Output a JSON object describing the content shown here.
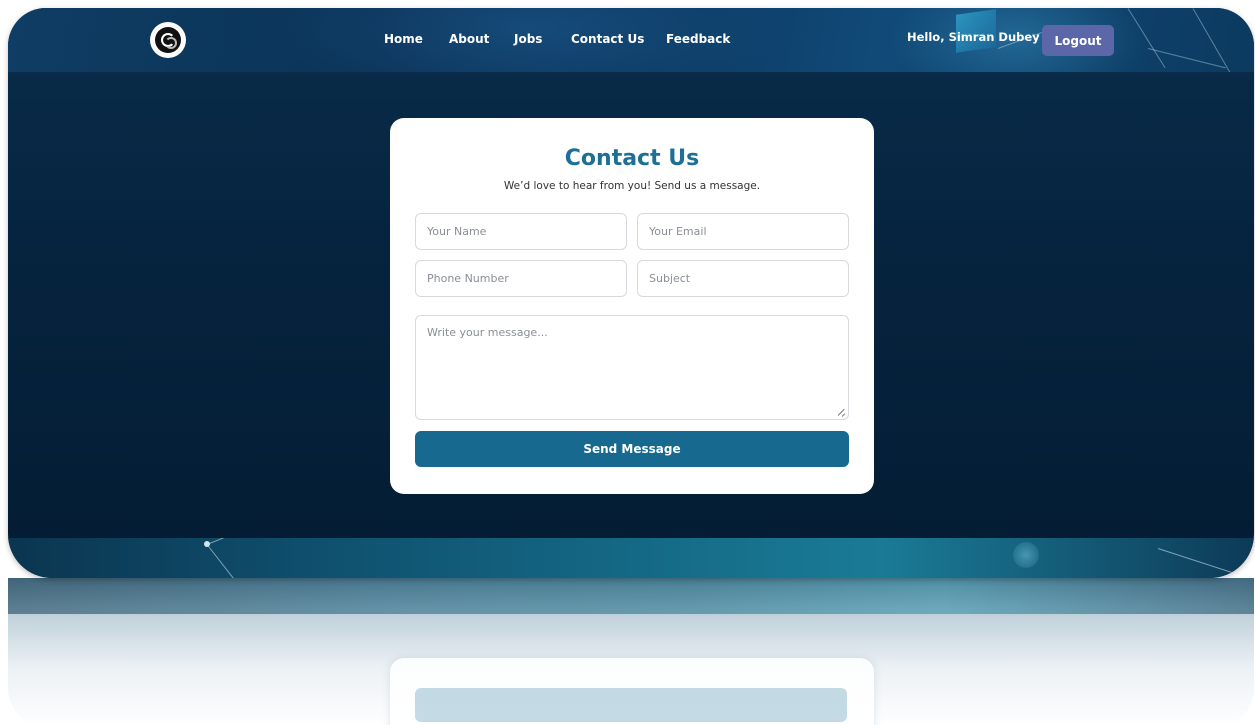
{
  "nav": {
    "links": [
      "Home",
      "About",
      "Jobs",
      "Contact Us",
      "Feedback"
    ],
    "greeting": "Hello, Simran Dubey",
    "logout_label": "Logout"
  },
  "contact": {
    "title": "Contact Us",
    "subtitle": "We’d love to hear from you! Send us a message.",
    "fields": {
      "name_placeholder": "Your Name",
      "email_placeholder": "Your Email",
      "phone_placeholder": "Phone Number",
      "subject_placeholder": "Subject",
      "message_placeholder": "Write your message..."
    },
    "send_label": "Send Message"
  },
  "icons": {
    "logo": "circular-logo-icon",
    "resize": "textarea-resize-icon"
  },
  "colors": {
    "accent": "#1d6f96",
    "button": "#17698f",
    "logout": "#5b67a8",
    "background": "#06243f"
  }
}
